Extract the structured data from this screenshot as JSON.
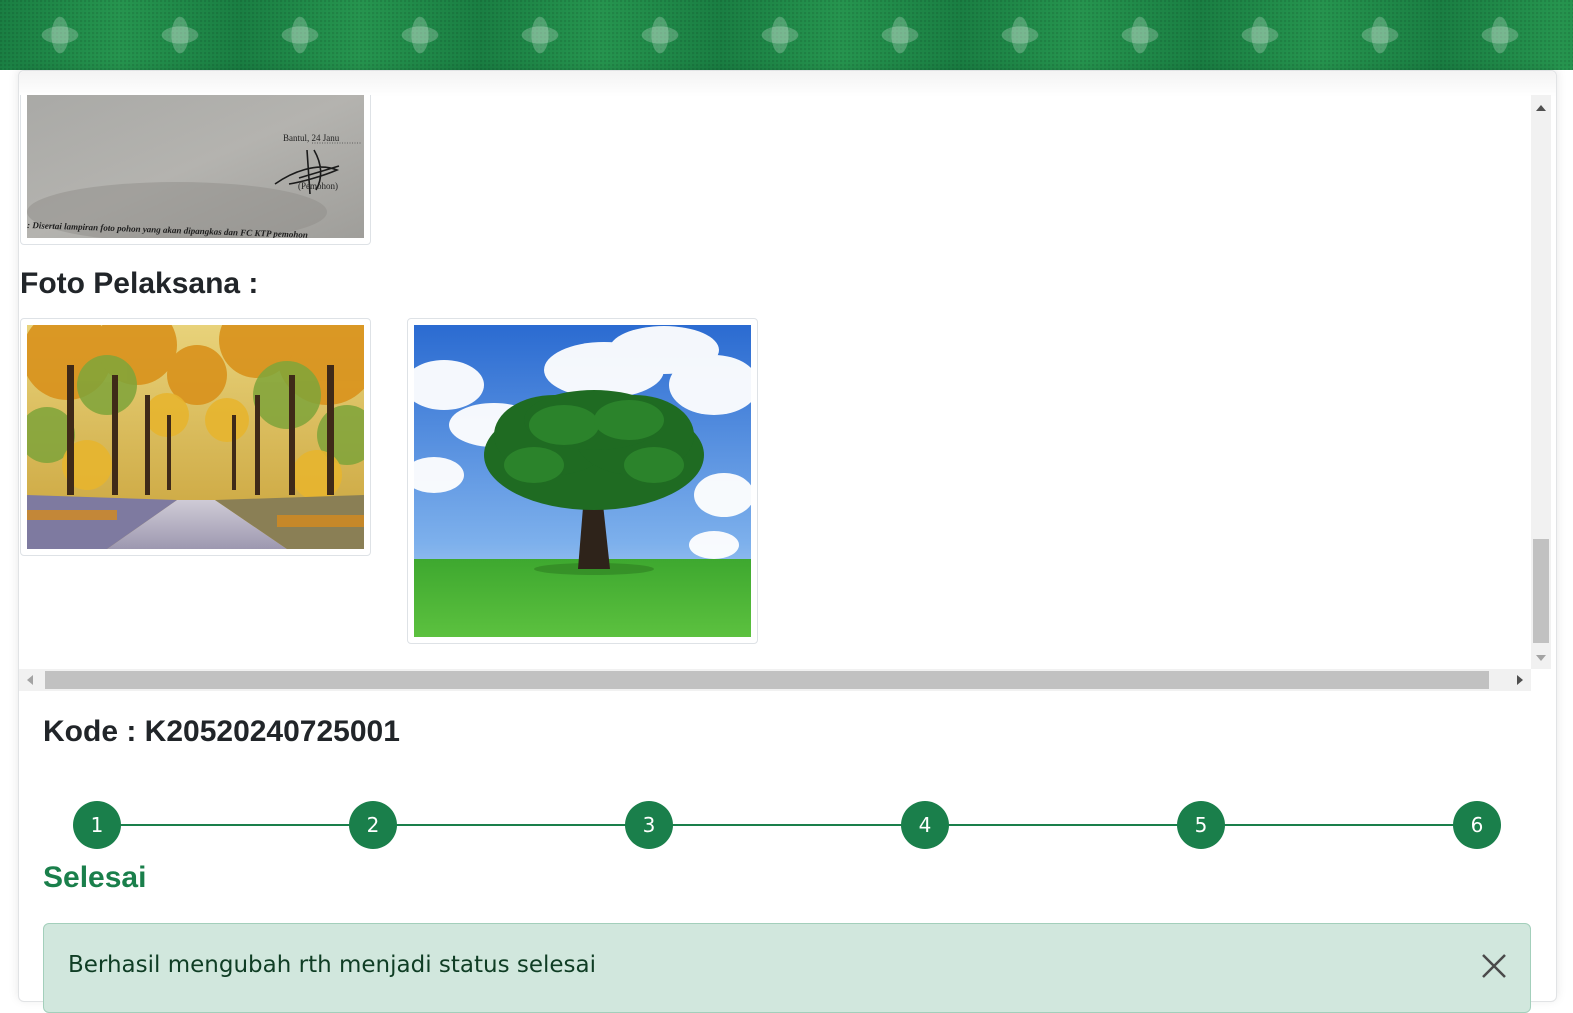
{
  "foto_pelaksana": {
    "heading": "Foto Pelaksana :"
  },
  "permohonan_document": {
    "place_date": "Bantul, 24 Janu",
    "signer_label": "(Pemohon)",
    "footnote": ": Disertai lampiran foto pohon yang akan dipangkas dan FC KTP pemohon"
  },
  "detail": {
    "kode_text": "Kode : K20520240725001"
  },
  "stepper": {
    "steps": [
      "1",
      "2",
      "3",
      "4",
      "5",
      "6"
    ],
    "color": "#1a7f4b"
  },
  "status": {
    "label": "Selesai",
    "color": "#1a7f4b"
  },
  "alert": {
    "message": "Berhasil mengubah rth menjadi status selesai",
    "background": "#d1e7dd"
  },
  "icons": {
    "close": "close-icon"
  }
}
